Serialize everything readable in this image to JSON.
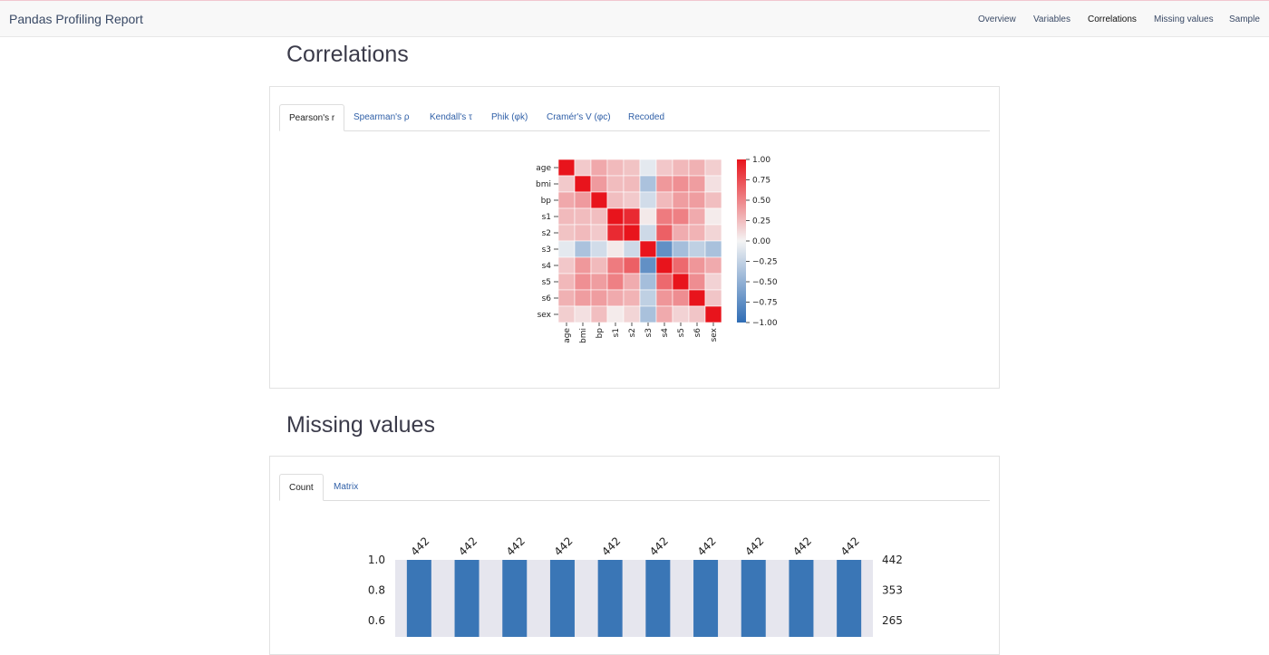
{
  "navbar": {
    "brand": "Pandas Profiling Report",
    "items": [
      {
        "label": "Overview"
      },
      {
        "label": "Variables"
      },
      {
        "label": "Correlations"
      },
      {
        "label": "Missing values"
      },
      {
        "label": "Sample"
      }
    ],
    "active": "Correlations"
  },
  "correlations": {
    "title": "Correlations",
    "tabs": [
      {
        "label": "Pearson's r"
      },
      {
        "label": "Spearman's ρ"
      },
      {
        "label": "Kendall's τ"
      },
      {
        "label": "Phik (φk)"
      },
      {
        "label": "Cramér's V (φc)"
      },
      {
        "label": "Recoded"
      }
    ],
    "active_tab": "Pearson's r"
  },
  "missing": {
    "title": "Missing values",
    "tabs": [
      {
        "label": "Count"
      },
      {
        "label": "Matrix"
      }
    ],
    "active_tab": "Count"
  },
  "chart_data": [
    {
      "type": "heatmap",
      "variables": [
        "age",
        "bmi",
        "bp",
        "s1",
        "s2",
        "s3",
        "s4",
        "s5",
        "s6",
        "sex"
      ],
      "matrix": [
        [
          1.0,
          0.19,
          0.34,
          0.26,
          0.22,
          -0.08,
          0.2,
          0.27,
          0.3,
          0.17
        ],
        [
          0.19,
          1.0,
          0.4,
          0.25,
          0.26,
          -0.37,
          0.41,
          0.45,
          0.39,
          0.09
        ],
        [
          0.34,
          0.4,
          1.0,
          0.24,
          0.19,
          -0.18,
          0.26,
          0.39,
          0.39,
          0.24
        ],
        [
          0.26,
          0.25,
          0.24,
          1.0,
          0.9,
          0.05,
          0.54,
          0.52,
          0.33,
          0.04
        ],
        [
          0.22,
          0.26,
          0.19,
          0.9,
          1.0,
          -0.2,
          0.66,
          0.32,
          0.29,
          0.14
        ],
        [
          -0.08,
          -0.37,
          -0.18,
          0.05,
          -0.2,
          1.0,
          -0.74,
          -0.4,
          -0.27,
          -0.38
        ],
        [
          0.2,
          0.41,
          0.26,
          0.54,
          0.66,
          -0.74,
          1.0,
          0.62,
          0.42,
          0.33
        ],
        [
          0.27,
          0.45,
          0.39,
          0.52,
          0.32,
          -0.4,
          0.62,
          1.0,
          0.46,
          0.15
        ],
        [
          0.3,
          0.39,
          0.39,
          0.33,
          0.29,
          -0.27,
          0.42,
          0.46,
          1.0,
          0.21
        ],
        [
          0.17,
          0.09,
          0.24,
          0.04,
          0.14,
          -0.38,
          0.33,
          0.15,
          0.21,
          1.0
        ]
      ],
      "colorbar": {
        "range": [
          -1.0,
          1.0
        ],
        "ticks": [
          "1.00",
          "0.75",
          "0.50",
          "0.25",
          "0.00",
          "−0.25",
          "−0.50",
          "−0.75",
          "−1.00"
        ]
      },
      "colors": {
        "positive": "#e8141c",
        "neutral": "#f4f4f4",
        "negative": "#2f6db5"
      }
    },
    {
      "type": "bar",
      "values": [
        442,
        442,
        442,
        442,
        442,
        442,
        442,
        442,
        442,
        442
      ],
      "value_labels": [
        "442",
        "442",
        "442",
        "442",
        "442",
        "442",
        "442",
        "442",
        "442",
        "442"
      ],
      "left_ticks": [
        "1.0",
        "0.8",
        "0.6"
      ],
      "right_ticks": [
        "442",
        "353",
        "265"
      ],
      "colors": {
        "bar": "#3a76b6",
        "background": "#e6e6ee"
      }
    }
  ]
}
